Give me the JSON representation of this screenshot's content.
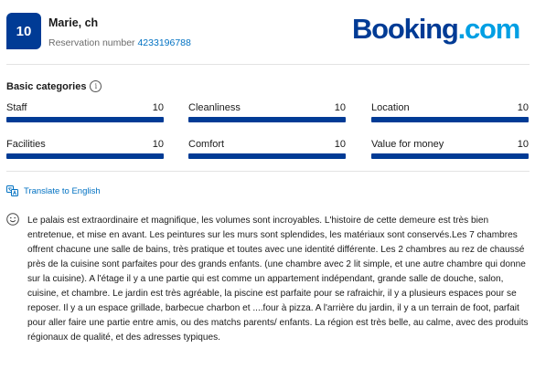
{
  "header": {
    "score": "10",
    "reviewer_name": "Marie, ch",
    "reservation_label": "Reservation number",
    "reservation_number": "4233196788",
    "logo": {
      "part1": "Booking",
      "part2": ".com",
      "color_primary": "#003b95",
      "color_accent": "#009fe3"
    }
  },
  "categories": {
    "title": "Basic categories",
    "info_icon": "info-icon",
    "bar_color": "#003b95",
    "items": [
      {
        "label": "Staff",
        "value": "10",
        "fill": 1.0
      },
      {
        "label": "Cleanliness",
        "value": "10",
        "fill": 1.0
      },
      {
        "label": "Location",
        "value": "10",
        "fill": 1.0
      },
      {
        "label": "Facilities",
        "value": "10",
        "fill": 1.0
      },
      {
        "label": "Comfort",
        "value": "10",
        "fill": 1.0
      },
      {
        "label": "Value for money",
        "value": "10",
        "fill": 1.0
      }
    ]
  },
  "translate": {
    "label": "Translate to English",
    "icon": "translate-icon"
  },
  "review": {
    "icon": "smile-icon",
    "text": "Le palais est extraordinaire et magnifique, les volumes sont incroyables. L'histoire de cette demeure est très bien entretenue, et mise en avant. Les peintures sur les murs sont splendides, les matériaux sont conservés.Les 7 chambres offrent chacune une salle de bains, très pratique et toutes avec une identité différente. Les 2 chambres au rez de chaussé près de la cuisine sont parfaites pour des grands enfants. (une chambre avec 2 lit simple, et une autre chambre qui donne sur la cuisine). A l'étage il y a une partie qui est comme un appartement indépendant, grande salle de douche, salon, cuisine, et chambre. Le jardin est très agréable, la piscine est parfaite pour se rafraichir, il y a plusieurs espaces pour se reposer. Il y a un espace grillade, barbecue charbon et ....four à pizza. A l'arrière du jardin, il y a un terrain de foot, parfait pour aller faire une partie entre amis, ou des matchs parents/ enfants. La région est très belle, au calme, avec des produits régionaux de qualité, et des adresses typiques."
  }
}
